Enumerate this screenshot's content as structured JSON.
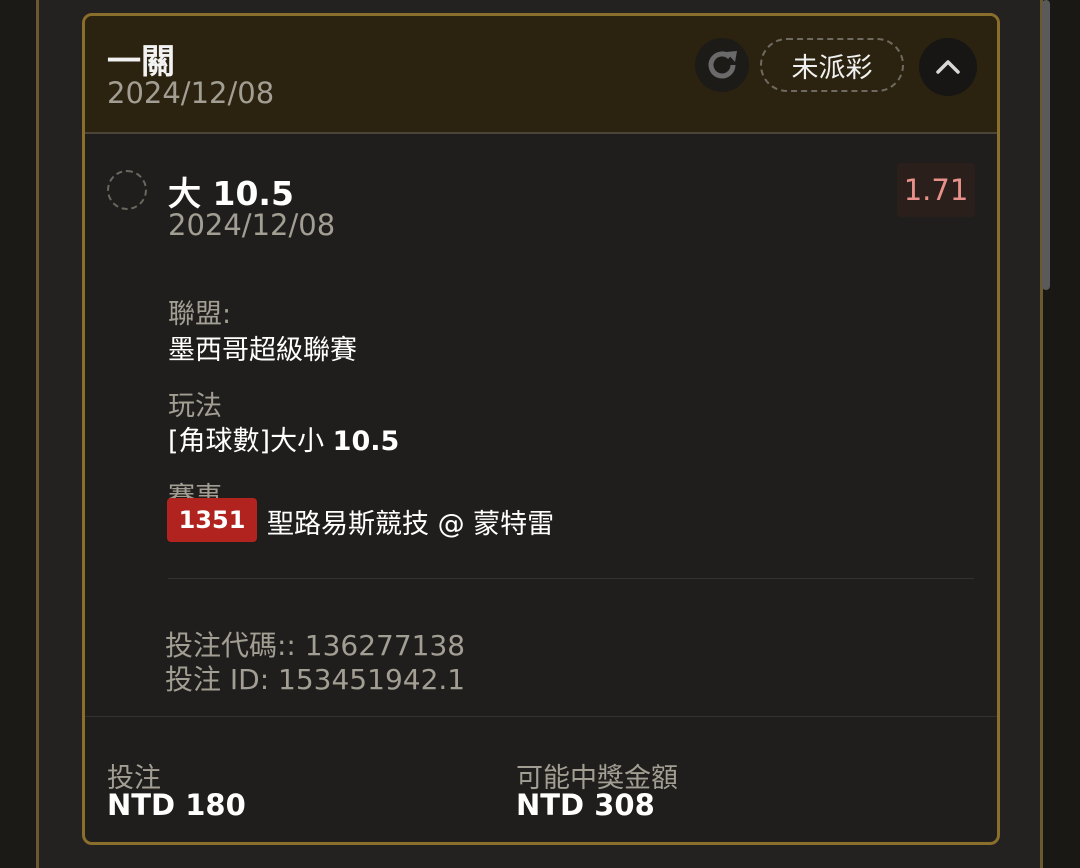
{
  "card": {
    "title": "一關",
    "date": "2024/12/08",
    "status": "未派彩",
    "refresh_icon": "refresh-icon",
    "collapse_icon": "chevron-up-icon"
  },
  "bet": {
    "selection_text": "大",
    "selection_number": "10.5",
    "date": "2024/12/08",
    "odds": "1.71",
    "league_label": "聯盟:",
    "league_value": "墨西哥超級聯賽",
    "market_label": "玩法",
    "market_value_text": "[角球數]大小",
    "market_value_number": "10.5",
    "event_label": "賽事",
    "match_id": "1351",
    "match_name": "聖路易斯競技 @ 蒙特雷",
    "bet_code_line": "投注代碼:: 136277138",
    "bet_id_line": "投注 ID: 153451942.1"
  },
  "summary": {
    "stake_label": "投注",
    "stake_value": "NTD 180",
    "payout_label": "可能中獎金額",
    "payout_value": "NTD 308"
  },
  "colors": {
    "accent_border": "#8a6f2c",
    "header_bg": "#2b2310",
    "odds_text": "#e8918a",
    "match_badge": "#b0231e"
  }
}
